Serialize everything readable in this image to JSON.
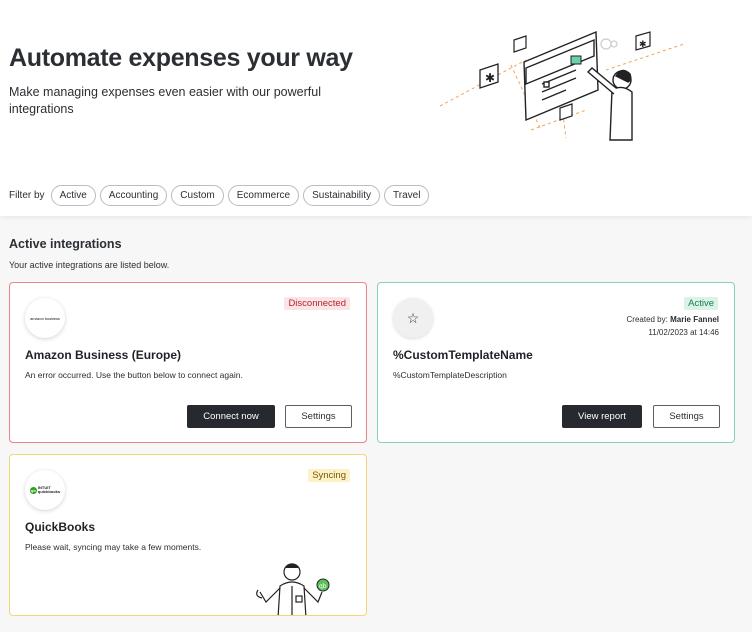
{
  "hero": {
    "title": "Automate expenses your way",
    "subtitle": "Make managing expenses even easier with our powerful integrations"
  },
  "filter": {
    "label": "Filter by",
    "chips": [
      "Active",
      "Accounting",
      "Custom",
      "Ecommerce",
      "Sustainability",
      "Travel"
    ]
  },
  "section": {
    "title": "Active integrations",
    "subtitle": "Your active integrations are listed below."
  },
  "cards": [
    {
      "logo_text": "amazon business",
      "status": "Disconnected",
      "title": "Amazon Business (Europe)",
      "description": "An error occurred. Use the button below to connect again.",
      "primary_button": "Connect now",
      "secondary_button": "Settings",
      "border_color": "#e6868a"
    },
    {
      "logo_icon": "star-icon",
      "status": "Active",
      "created_by_label": "Created by:",
      "created_by_name": "Marie Fannel",
      "created_date": "11/02/2023 at 14:46",
      "title": "%CustomTemplateName",
      "description": "%CustomTemplateDescription",
      "primary_button": "View report",
      "secondary_button": "Settings",
      "border_color": "#86d2b2"
    },
    {
      "logo_text_1": "INTUIT",
      "logo_text_2": "quickbooks",
      "status": "Syncing",
      "title": "QuickBooks",
      "description": "Please wait, syncing may take a few moments.",
      "border_color": "#f0d57d"
    }
  ]
}
